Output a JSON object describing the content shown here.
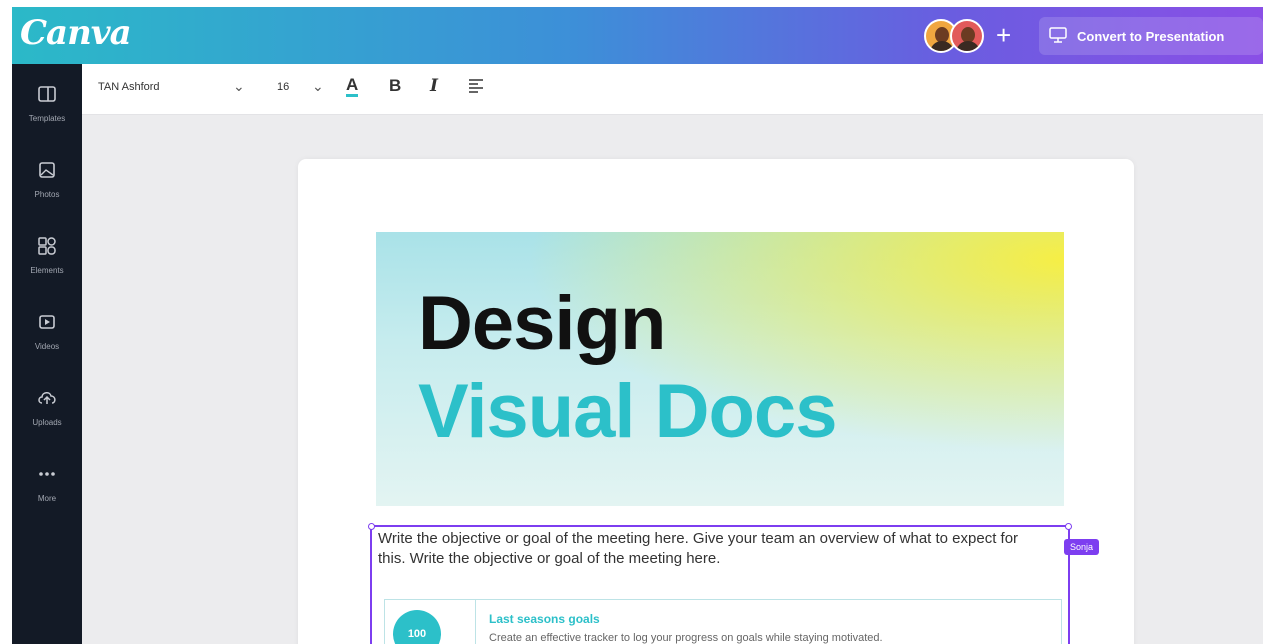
{
  "header": {
    "logo": "Canva",
    "add_label": "+",
    "convert_label": "Convert to Presentation"
  },
  "sidebar": {
    "items": [
      {
        "label": "Templates",
        "icon": "templates-icon"
      },
      {
        "label": "Photos",
        "icon": "photos-icon"
      },
      {
        "label": "Elements",
        "icon": "elements-icon"
      },
      {
        "label": "Videos",
        "icon": "videos-icon"
      },
      {
        "label": "Uploads",
        "icon": "uploads-icon"
      },
      {
        "label": "More",
        "icon": "more-icon"
      }
    ]
  },
  "toolbar": {
    "font_name": "TAN Ashford",
    "font_size": "16",
    "text_color_glyph": "A",
    "bold_glyph": "B",
    "italic_glyph": "I"
  },
  "document": {
    "hero_title": "Design",
    "hero_subtitle": "Visual Docs",
    "body_text": "Write the objective or goal of the meeting here. Give your team an overview of what to expect for this. Write the objective or goal of the meeting here.",
    "collaborator_tag": "Sonja",
    "goals_title": "Last seasons goals",
    "goals_text": "Create an effective tracker to log your progress on goals while staying motivated.",
    "goals_badge": "100"
  },
  "colors": {
    "brand_teal": "#2cc0c9",
    "selection_purple": "#7d3ef0",
    "sidebar_bg": "#131a26"
  }
}
